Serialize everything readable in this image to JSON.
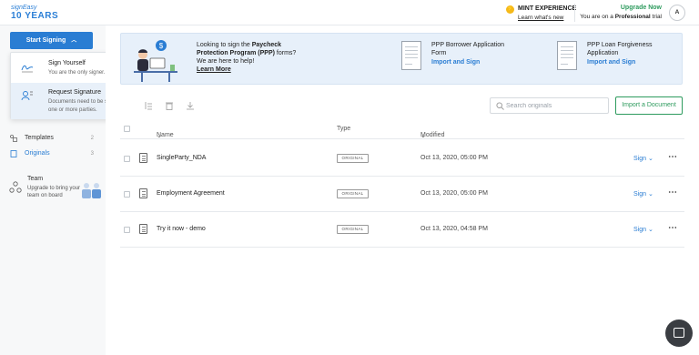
{
  "header": {
    "logo_line1": "signEasy",
    "logo_line2": "10 YEARS",
    "mint_title": "MINT EXPERIENCE",
    "mint_link": "Learn what's new",
    "upgrade_link": "Upgrade Now",
    "trial_prefix": "You are on a ",
    "trial_plan": "Professional",
    "trial_suffix": " trial",
    "avatar_initial": "A"
  },
  "sidebar": {
    "start_button": "Start Signing",
    "items": [
      {
        "label": "Templates",
        "count": "2",
        "icon": "templates-icon"
      },
      {
        "label": "Originals",
        "count": "3",
        "icon": "originals-icon"
      }
    ],
    "team": {
      "title": "Team",
      "subtitle": "Upgrade to bring your team on board"
    }
  },
  "dropdown": {
    "items": [
      {
        "title": "Sign Yourself",
        "subtitle": "You are the only signer."
      },
      {
        "title": "Request Signature",
        "subtitle": "Documents need to be signed by one or more parties."
      }
    ]
  },
  "banner": {
    "text_pre": "Looking to sign the ",
    "text_bold": "Paycheck Protection Program (PPP)",
    "text_post": " forms? We are here to help!",
    "learn_more": "Learn More",
    "cards": [
      {
        "title": "PPP Borrower Application Form",
        "link": "Import and Sign"
      },
      {
        "title": "PPP Loan Forgiveness Application",
        "link": "Import and Sign"
      }
    ]
  },
  "toolbar": {
    "search_placeholder": "Search originals",
    "import_button": "Import a Document"
  },
  "table": {
    "columns": {
      "name": "Name",
      "type": "Type",
      "modified": "Modified"
    },
    "rows": [
      {
        "name": "SingleParty_NDA",
        "type": "ORIGINAL",
        "modified": "Oct 13, 2020, 05:00 PM",
        "action": "Sign"
      },
      {
        "name": "Employment Agreement",
        "type": "ORIGINAL",
        "modified": "Oct 13, 2020, 05:00 PM",
        "action": "Sign"
      },
      {
        "name": "Try it now - demo",
        "type": "ORIGINAL",
        "modified": "Oct 13, 2020, 04:58 PM",
        "action": "Sign"
      }
    ]
  },
  "colors": {
    "accent_blue": "#2a7dd3",
    "accent_green": "#2e9b5e",
    "banner_bg": "#e7f0fa",
    "mint_yellow": "#f5b919"
  }
}
